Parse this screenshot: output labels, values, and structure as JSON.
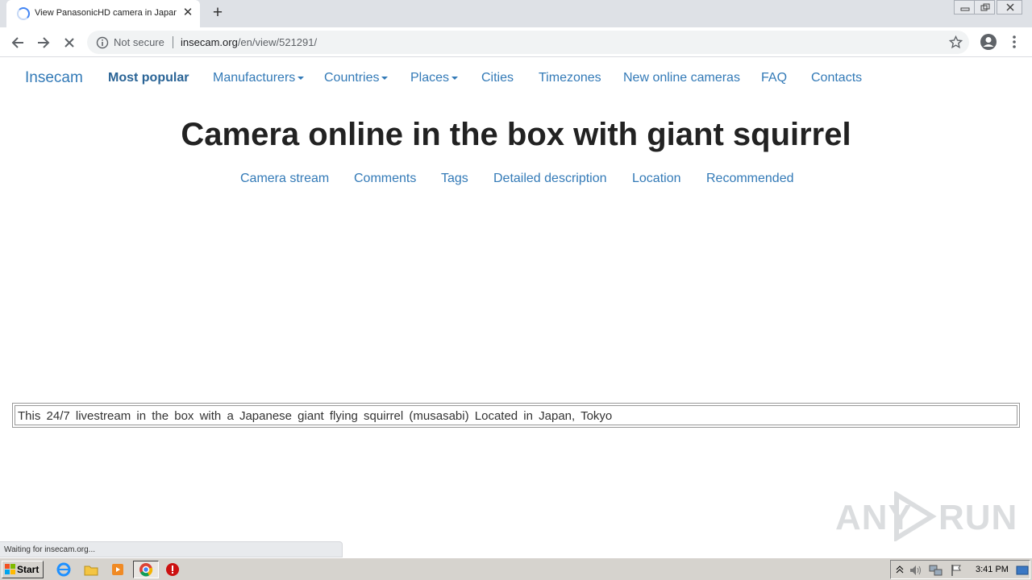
{
  "browser": {
    "tab_title": "View PanasonicHD camera in Japan,",
    "tab_close": "✕",
    "new_tab": "+",
    "security_label": "Not secure",
    "url_host": "insecam.org",
    "url_path": "/en/view/521291/",
    "status_text": "Waiting for insecam.org..."
  },
  "site": {
    "brand": "Insecam",
    "nav": [
      {
        "label": "Most popular",
        "dropdown": false,
        "active": true
      },
      {
        "label": "Manufacturers",
        "dropdown": true
      },
      {
        "label": "Countries",
        "dropdown": true
      },
      {
        "label": "Places",
        "dropdown": true
      },
      {
        "label": "Cities",
        "dropdown": false
      },
      {
        "label": "Timezones",
        "dropdown": false
      },
      {
        "label": "New online cameras",
        "dropdown": false
      },
      {
        "label": "FAQ",
        "dropdown": false
      },
      {
        "label": "Contacts",
        "dropdown": false
      }
    ],
    "headline": "Camera online in the box with giant squirrel",
    "subnav": [
      "Camera stream",
      "Comments",
      "Tags",
      "Detailed description",
      "Location",
      "Recommended"
    ],
    "description": "This 24/7 livestream in the box with a Japanese giant flying squirrel (musasabi) Located in Japan, Tokyo"
  },
  "watermark": {
    "left": "ANY",
    "right": "RUN"
  },
  "taskbar": {
    "start_label": "Start",
    "clock": "3:41 PM"
  },
  "colors": {
    "link": "#337ab7",
    "chrome_frame": "#dee1e6",
    "taskbar": "#d6d3ce"
  }
}
